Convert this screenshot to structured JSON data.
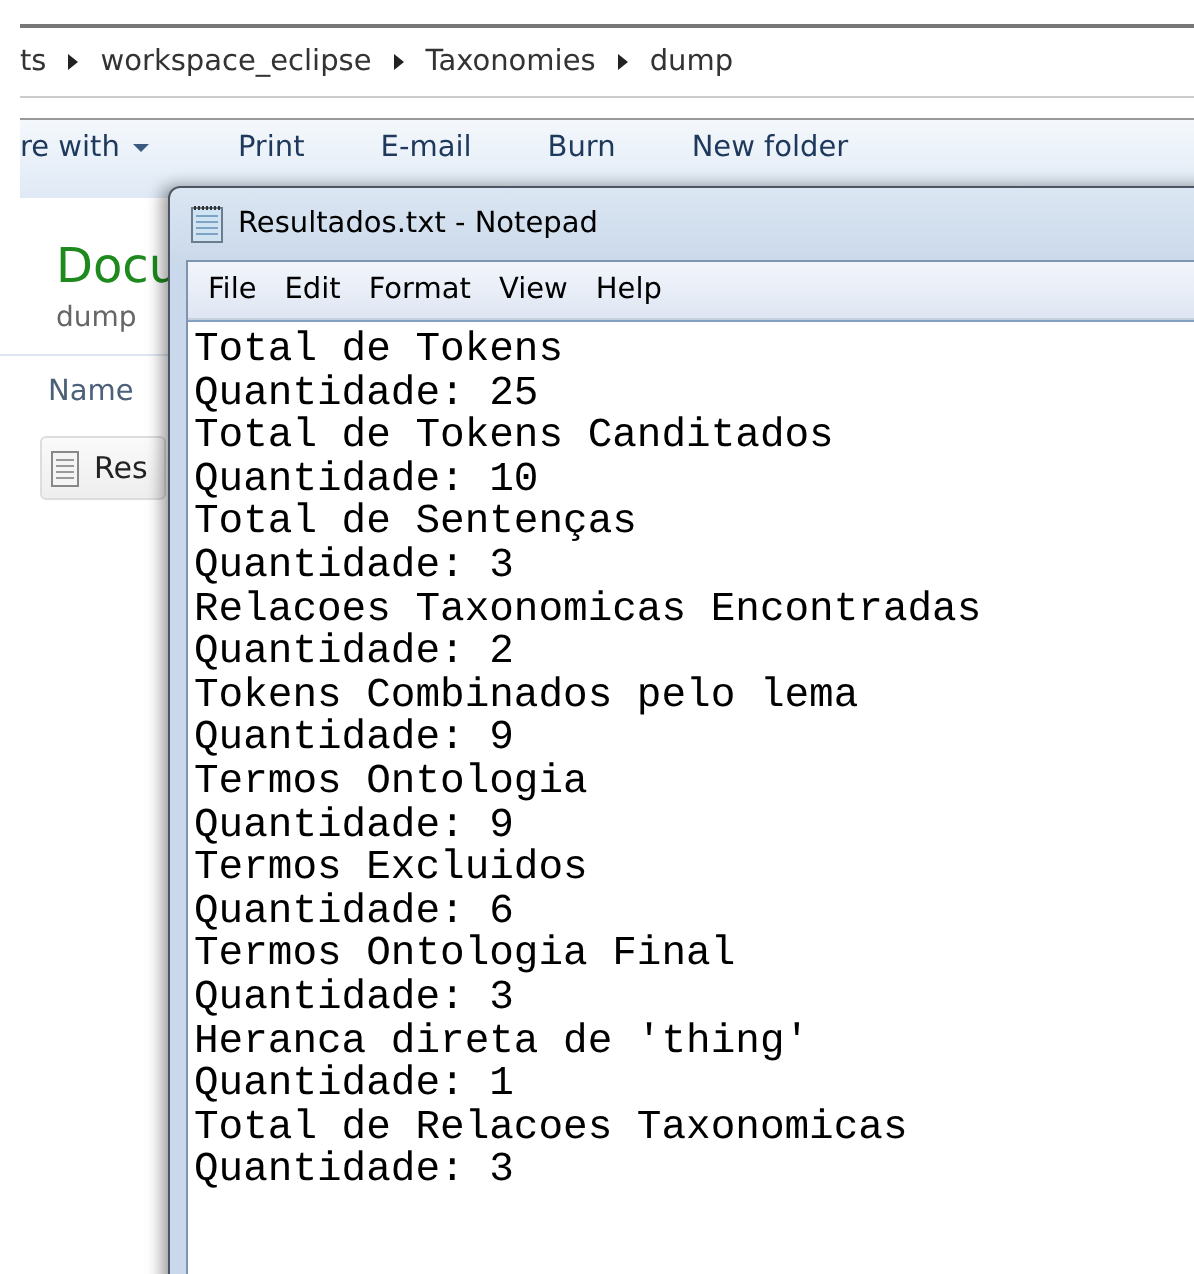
{
  "explorer": {
    "breadcrumb": [
      "ts",
      "workspace_eclipse",
      "Taxonomies",
      "dump"
    ],
    "toolbar": [
      {
        "label": "re with",
        "dropdown": true
      },
      {
        "label": "Print",
        "dropdown": false
      },
      {
        "label": "E-mail",
        "dropdown": false
      },
      {
        "label": "Burn",
        "dropdown": false
      },
      {
        "label": "New folder",
        "dropdown": false
      }
    ],
    "heading": "Docu",
    "subheading": "dump",
    "column": "Name",
    "file": "Res"
  },
  "notepad": {
    "title": "Resultados.txt - Notepad",
    "menu": [
      "File",
      "Edit",
      "Format",
      "View",
      "Help"
    ],
    "lines": [
      "Total de Tokens",
      "Quantidade: 25",
      "Total de Tokens Canditados",
      "Quantidade: 10",
      "Total de Sentenças",
      "Quantidade: 3",
      "Relacoes Taxonomicas Encontradas",
      "Quantidade: 2",
      "Tokens Combinados pelo lema",
      "Quantidade: 9",
      "Termos Ontologia",
      "Quantidade: 9",
      "Termos Excluidos",
      "Quantidade: 6",
      "Termos Ontologia Final",
      "Quantidade: 3",
      "Heranca direta de 'thing'",
      "Quantidade: 1",
      "Total de Relacoes Taxonomicas",
      "Quantidade: 3"
    ]
  }
}
